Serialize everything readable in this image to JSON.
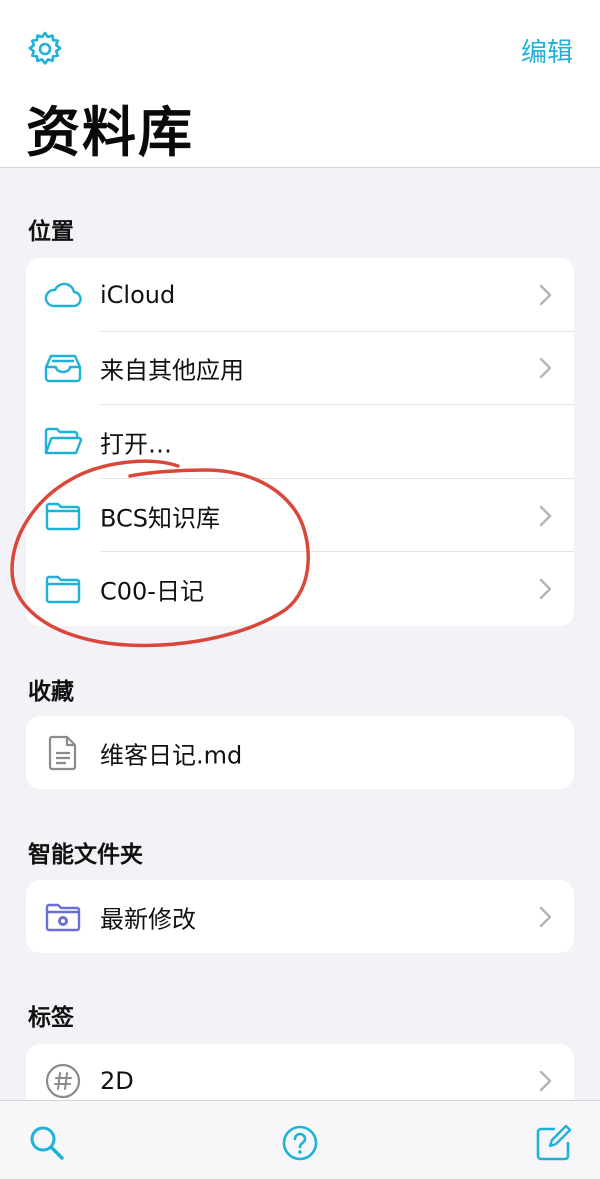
{
  "header": {
    "title": "资料库",
    "edit_label": "编辑"
  },
  "colors": {
    "accent": "#1fb1d8",
    "smart_folder": "#6a6fd8",
    "annotation": "#d9473a"
  },
  "locations": {
    "title": "位置",
    "items": [
      {
        "label": "iCloud",
        "icon": "cloud-icon",
        "chevron": true
      },
      {
        "label": "来自其他应用",
        "icon": "inbox-tray-icon",
        "chevron": true
      },
      {
        "label": "打开…",
        "icon": "open-folder-icon",
        "chevron": false
      },
      {
        "label": "BCS知识库",
        "icon": "folder-icon",
        "chevron": true
      },
      {
        "label": "C00-日记",
        "icon": "folder-icon",
        "chevron": true
      }
    ]
  },
  "favorites": {
    "title": "收藏",
    "items": [
      {
        "label": "维客日记.md",
        "icon": "document-icon",
        "chevron": false
      }
    ]
  },
  "smart_folders": {
    "title": "智能文件夹",
    "items": [
      {
        "label": "最新修改",
        "icon": "gear-folder-icon",
        "chevron": true
      }
    ]
  },
  "tags": {
    "title": "标签",
    "items": [
      {
        "label": "2D",
        "icon": "hashtag-icon",
        "chevron": true
      }
    ]
  },
  "tabbar": {
    "items": [
      "search-icon",
      "help-icon",
      "compose-icon"
    ]
  }
}
